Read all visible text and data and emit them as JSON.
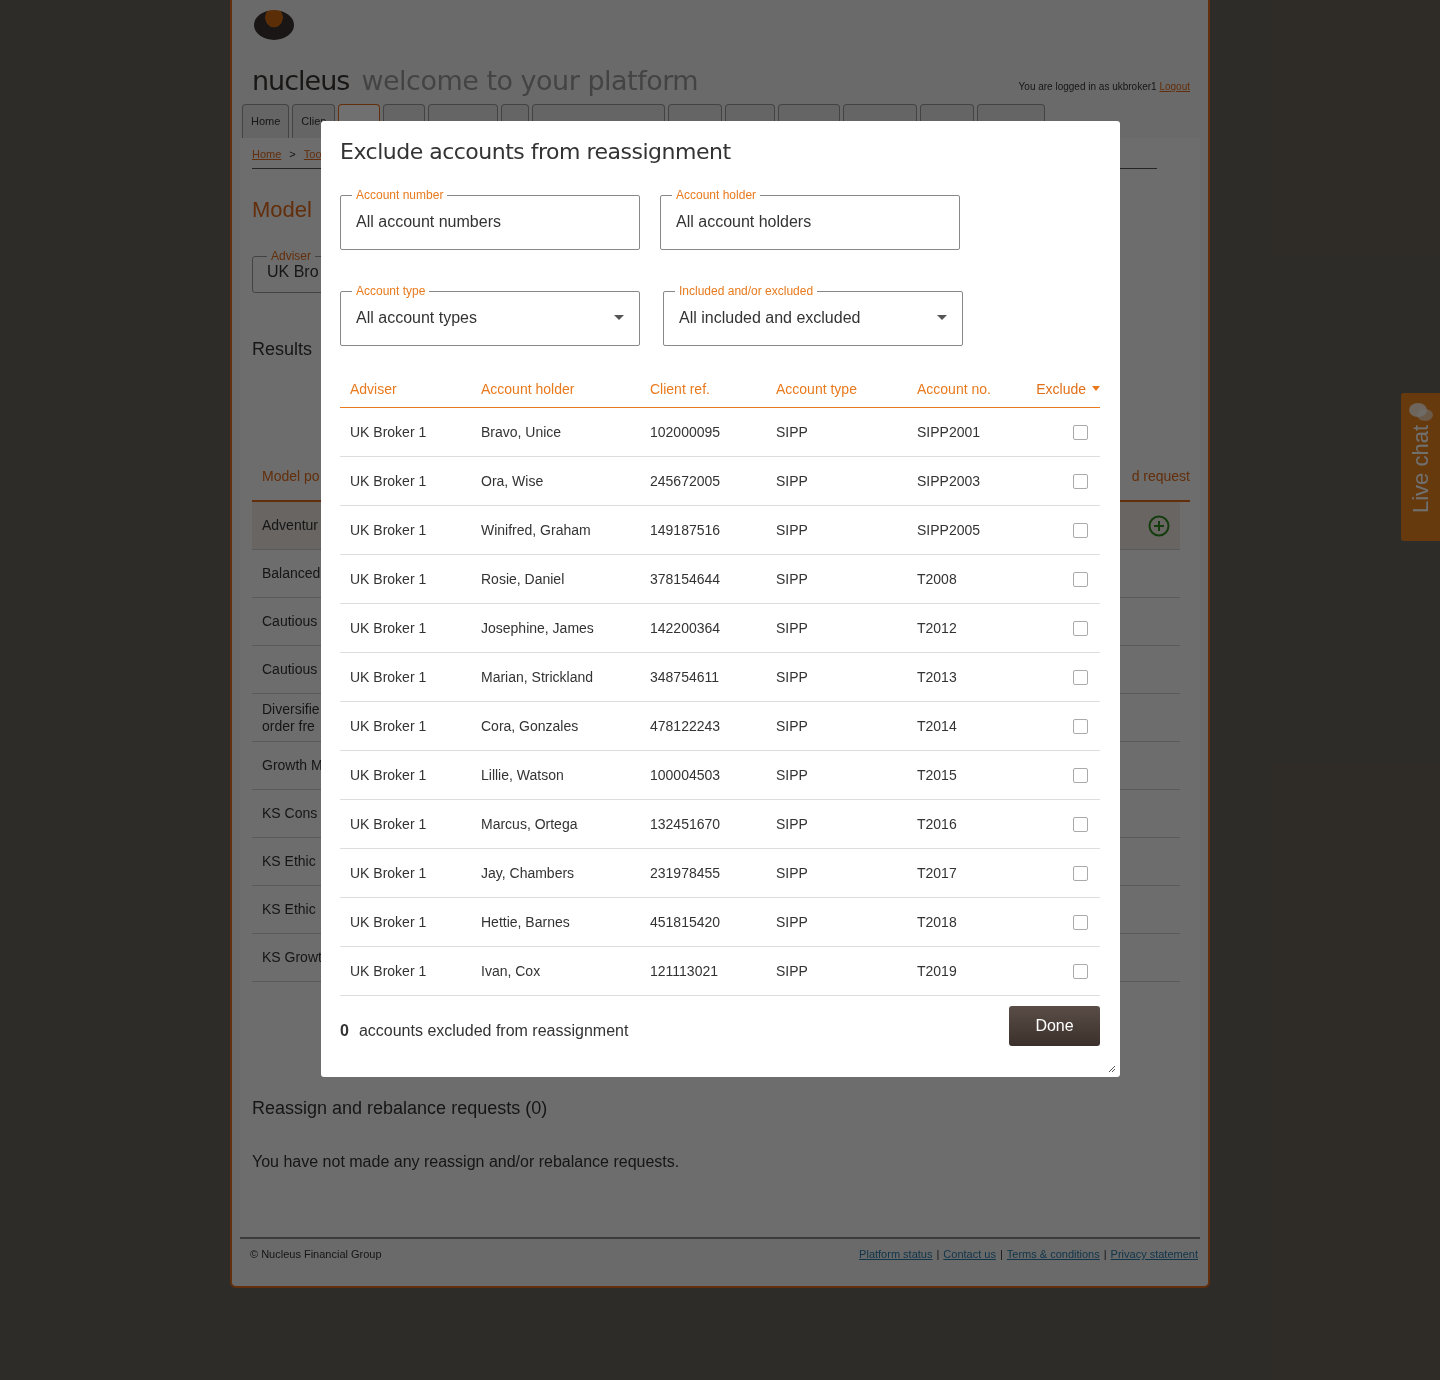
{
  "header": {
    "brand": "nucleus",
    "tagline": "welcome to your platform",
    "login_text": "You are logged in as ukbroker1",
    "logout_link": "Logout"
  },
  "tabs": [
    {
      "label": "Home",
      "selected": false
    },
    {
      "label": "Clien",
      "selected": false
    },
    {
      "selected": true
    },
    {
      "selected": false
    },
    {
      "selected": false
    },
    {
      "selected": false
    },
    {
      "selected": false
    },
    {
      "selected": false
    },
    {
      "selected": false
    },
    {
      "selected": false
    },
    {
      "selected": false
    },
    {
      "selected": false
    },
    {
      "selected": false
    }
  ],
  "breadcrumb": {
    "items": [
      "Home",
      "Too"
    ],
    "separator": ">"
  },
  "page_title": "Model",
  "adviser_field": {
    "label": "Adviser",
    "value": "UK Bro"
  },
  "results_heading": "Results",
  "models_table": {
    "columns": [
      "Model po",
      "d request"
    ],
    "rows": [
      {
        "name": "Adventur",
        "selected": true
      },
      {
        "name": "Balanced",
        "selected": false
      },
      {
        "name": "Cautious",
        "selected": false
      },
      {
        "name": "Cautious",
        "selected": false
      },
      {
        "name": "Diversifie\norder fre",
        "selected": false
      },
      {
        "name": "Growth M",
        "selected": false
      },
      {
        "name": "KS Cons",
        "selected": false
      },
      {
        "name": "KS Ethic",
        "selected": false
      },
      {
        "name": "KS Ethic",
        "selected": false
      },
      {
        "name": "KS Growt",
        "selected": false
      }
    ]
  },
  "requests": {
    "heading": "Reassign and rebalance requests (0)",
    "message": "You have not made any reassign and/or rebalance requests."
  },
  "footer": {
    "copyright": "© Nucleus Financial Group",
    "links": [
      "Platform status",
      "Contact us",
      "Terms & conditions",
      "Privacy statement"
    ],
    "separator": "|"
  },
  "live_chat": "Live chat",
  "modal": {
    "title": "Exclude accounts from reassignment",
    "filters": [
      {
        "kind": "text",
        "label": "Account number",
        "value": "All account numbers"
      },
      {
        "kind": "text",
        "label": "Account holder",
        "value": "All account holders"
      },
      {
        "kind": "select",
        "label": "Account type",
        "value": "All account types"
      },
      {
        "kind": "select",
        "label": "Included and/or excluded",
        "value": "All included and excluded"
      }
    ],
    "columns": [
      {
        "label": "Adviser",
        "sorted": false
      },
      {
        "label": "Account holder",
        "sorted": false
      },
      {
        "label": "Client ref.",
        "sorted": false
      },
      {
        "label": "Account type",
        "sorted": false
      },
      {
        "label": "Account no.",
        "sorted": false
      },
      {
        "label": "Exclude",
        "sorted": true
      }
    ],
    "rows": [
      {
        "adviser": "UK Broker 1",
        "holder": "Bravo, Unice",
        "ref": "102000095",
        "type": "SIPP",
        "number": "SIPP2001",
        "excluded": false
      },
      {
        "adviser": "UK Broker 1",
        "holder": "Ora, Wise",
        "ref": "245672005",
        "type": "SIPP",
        "number": "SIPP2003",
        "excluded": false
      },
      {
        "adviser": "UK Broker 1",
        "holder": "Winifred, Graham",
        "ref": "149187516",
        "type": "SIPP",
        "number": "SIPP2005",
        "excluded": false
      },
      {
        "adviser": "UK Broker 1",
        "holder": "Rosie, Daniel",
        "ref": "378154644",
        "type": "SIPP",
        "number": "T2008",
        "excluded": false
      },
      {
        "adviser": "UK Broker 1",
        "holder": "Josephine, James",
        "ref": "142200364",
        "type": "SIPP",
        "number": "T2012",
        "excluded": false
      },
      {
        "adviser": "UK Broker 1",
        "holder": "Marian, Strickland",
        "ref": "348754611",
        "type": "SIPP",
        "number": "T2013",
        "excluded": false
      },
      {
        "adviser": "UK Broker 1",
        "holder": "Cora, Gonzales",
        "ref": "478122243",
        "type": "SIPP",
        "number": "T2014",
        "excluded": false
      },
      {
        "adviser": "UK Broker 1",
        "holder": "Lillie, Watson",
        "ref": "100004503",
        "type": "SIPP",
        "number": "T2015",
        "excluded": false
      },
      {
        "adviser": "UK Broker 1",
        "holder": "Marcus, Ortega",
        "ref": "132451670",
        "type": "SIPP",
        "number": "T2016",
        "excluded": false
      },
      {
        "adviser": "UK Broker 1",
        "holder": "Jay, Chambers",
        "ref": "231978455",
        "type": "SIPP",
        "number": "T2017",
        "excluded": false
      },
      {
        "adviser": "UK Broker 1",
        "holder": "Hettie, Barnes",
        "ref": "451815420",
        "type": "SIPP",
        "number": "T2018",
        "excluded": false
      },
      {
        "adviser": "UK Broker 1",
        "holder": "Ivan, Cox",
        "ref": "121113021",
        "type": "SIPP",
        "number": "T2019",
        "excluded": false
      }
    ],
    "excluded_count": "0",
    "summary_text": "accounts excluded from reassignment",
    "done_button": "Done"
  }
}
